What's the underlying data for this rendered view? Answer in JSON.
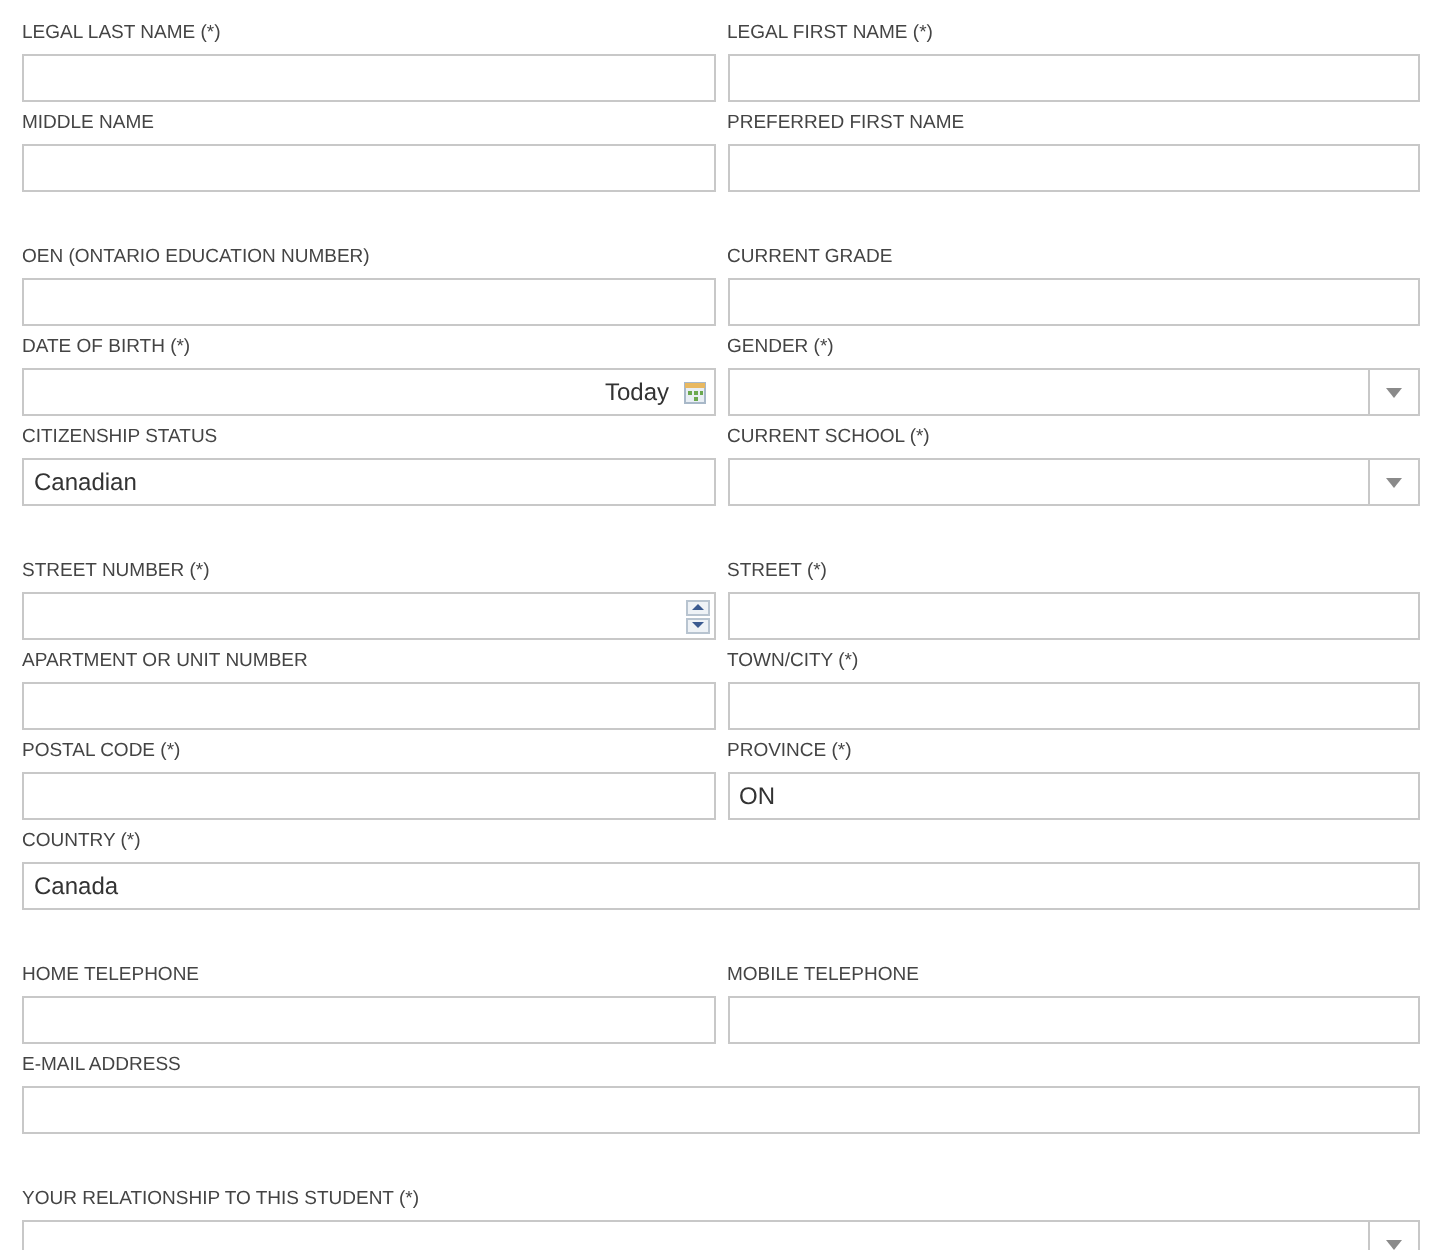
{
  "sections": [
    {
      "rows": [
        [
          {
            "label": "LEGAL LAST NAME (*)",
            "kind": "text"
          },
          {
            "label": "LEGAL FIRST NAME (*)",
            "kind": "text"
          }
        ],
        [
          {
            "label": "MIDDLE NAME",
            "kind": "text"
          },
          {
            "label": "PREFERRED FIRST NAME",
            "kind": "text"
          }
        ]
      ]
    },
    {
      "rows": [
        [
          {
            "label": "OEN (ONTARIO EDUCATION NUMBER)",
            "kind": "text"
          },
          {
            "label": "CURRENT GRADE",
            "kind": "text"
          }
        ],
        [
          {
            "label": "DATE OF BIRTH (*)",
            "kind": "date",
            "today": "Today"
          },
          {
            "label": "GENDER (*)",
            "kind": "select"
          }
        ],
        [
          {
            "label": "CITIZENSHIP STATUS",
            "kind": "text",
            "value": "Canadian"
          },
          {
            "label": "CURRENT SCHOOL (*)",
            "kind": "select"
          }
        ]
      ]
    },
    {
      "rows": [
        [
          {
            "label": "STREET NUMBER (*)",
            "kind": "number"
          },
          {
            "label": "STREET (*)",
            "kind": "text"
          }
        ],
        [
          {
            "label": "APARTMENT OR UNIT NUMBER",
            "kind": "text"
          },
          {
            "label": "TOWN/CITY (*)",
            "kind": "text"
          }
        ],
        [
          {
            "label": "POSTAL CODE (*)",
            "kind": "text"
          },
          {
            "label": "PROVINCE (*)",
            "kind": "text",
            "value": "ON"
          }
        ],
        [
          {
            "label": "COUNTRY (*)",
            "kind": "text",
            "value": "Canada"
          }
        ]
      ]
    },
    {
      "rows": [
        [
          {
            "label": "HOME TELEPHONE",
            "kind": "text"
          },
          {
            "label": "MOBILE TELEPHONE",
            "kind": "text"
          }
        ],
        [
          {
            "label": "E-MAIL ADDRESS",
            "kind": "text"
          }
        ]
      ]
    },
    {
      "rows": [
        [
          {
            "label": "YOUR RELATIONSHIP TO THIS STUDENT (*)",
            "kind": "select"
          }
        ]
      ]
    }
  ]
}
